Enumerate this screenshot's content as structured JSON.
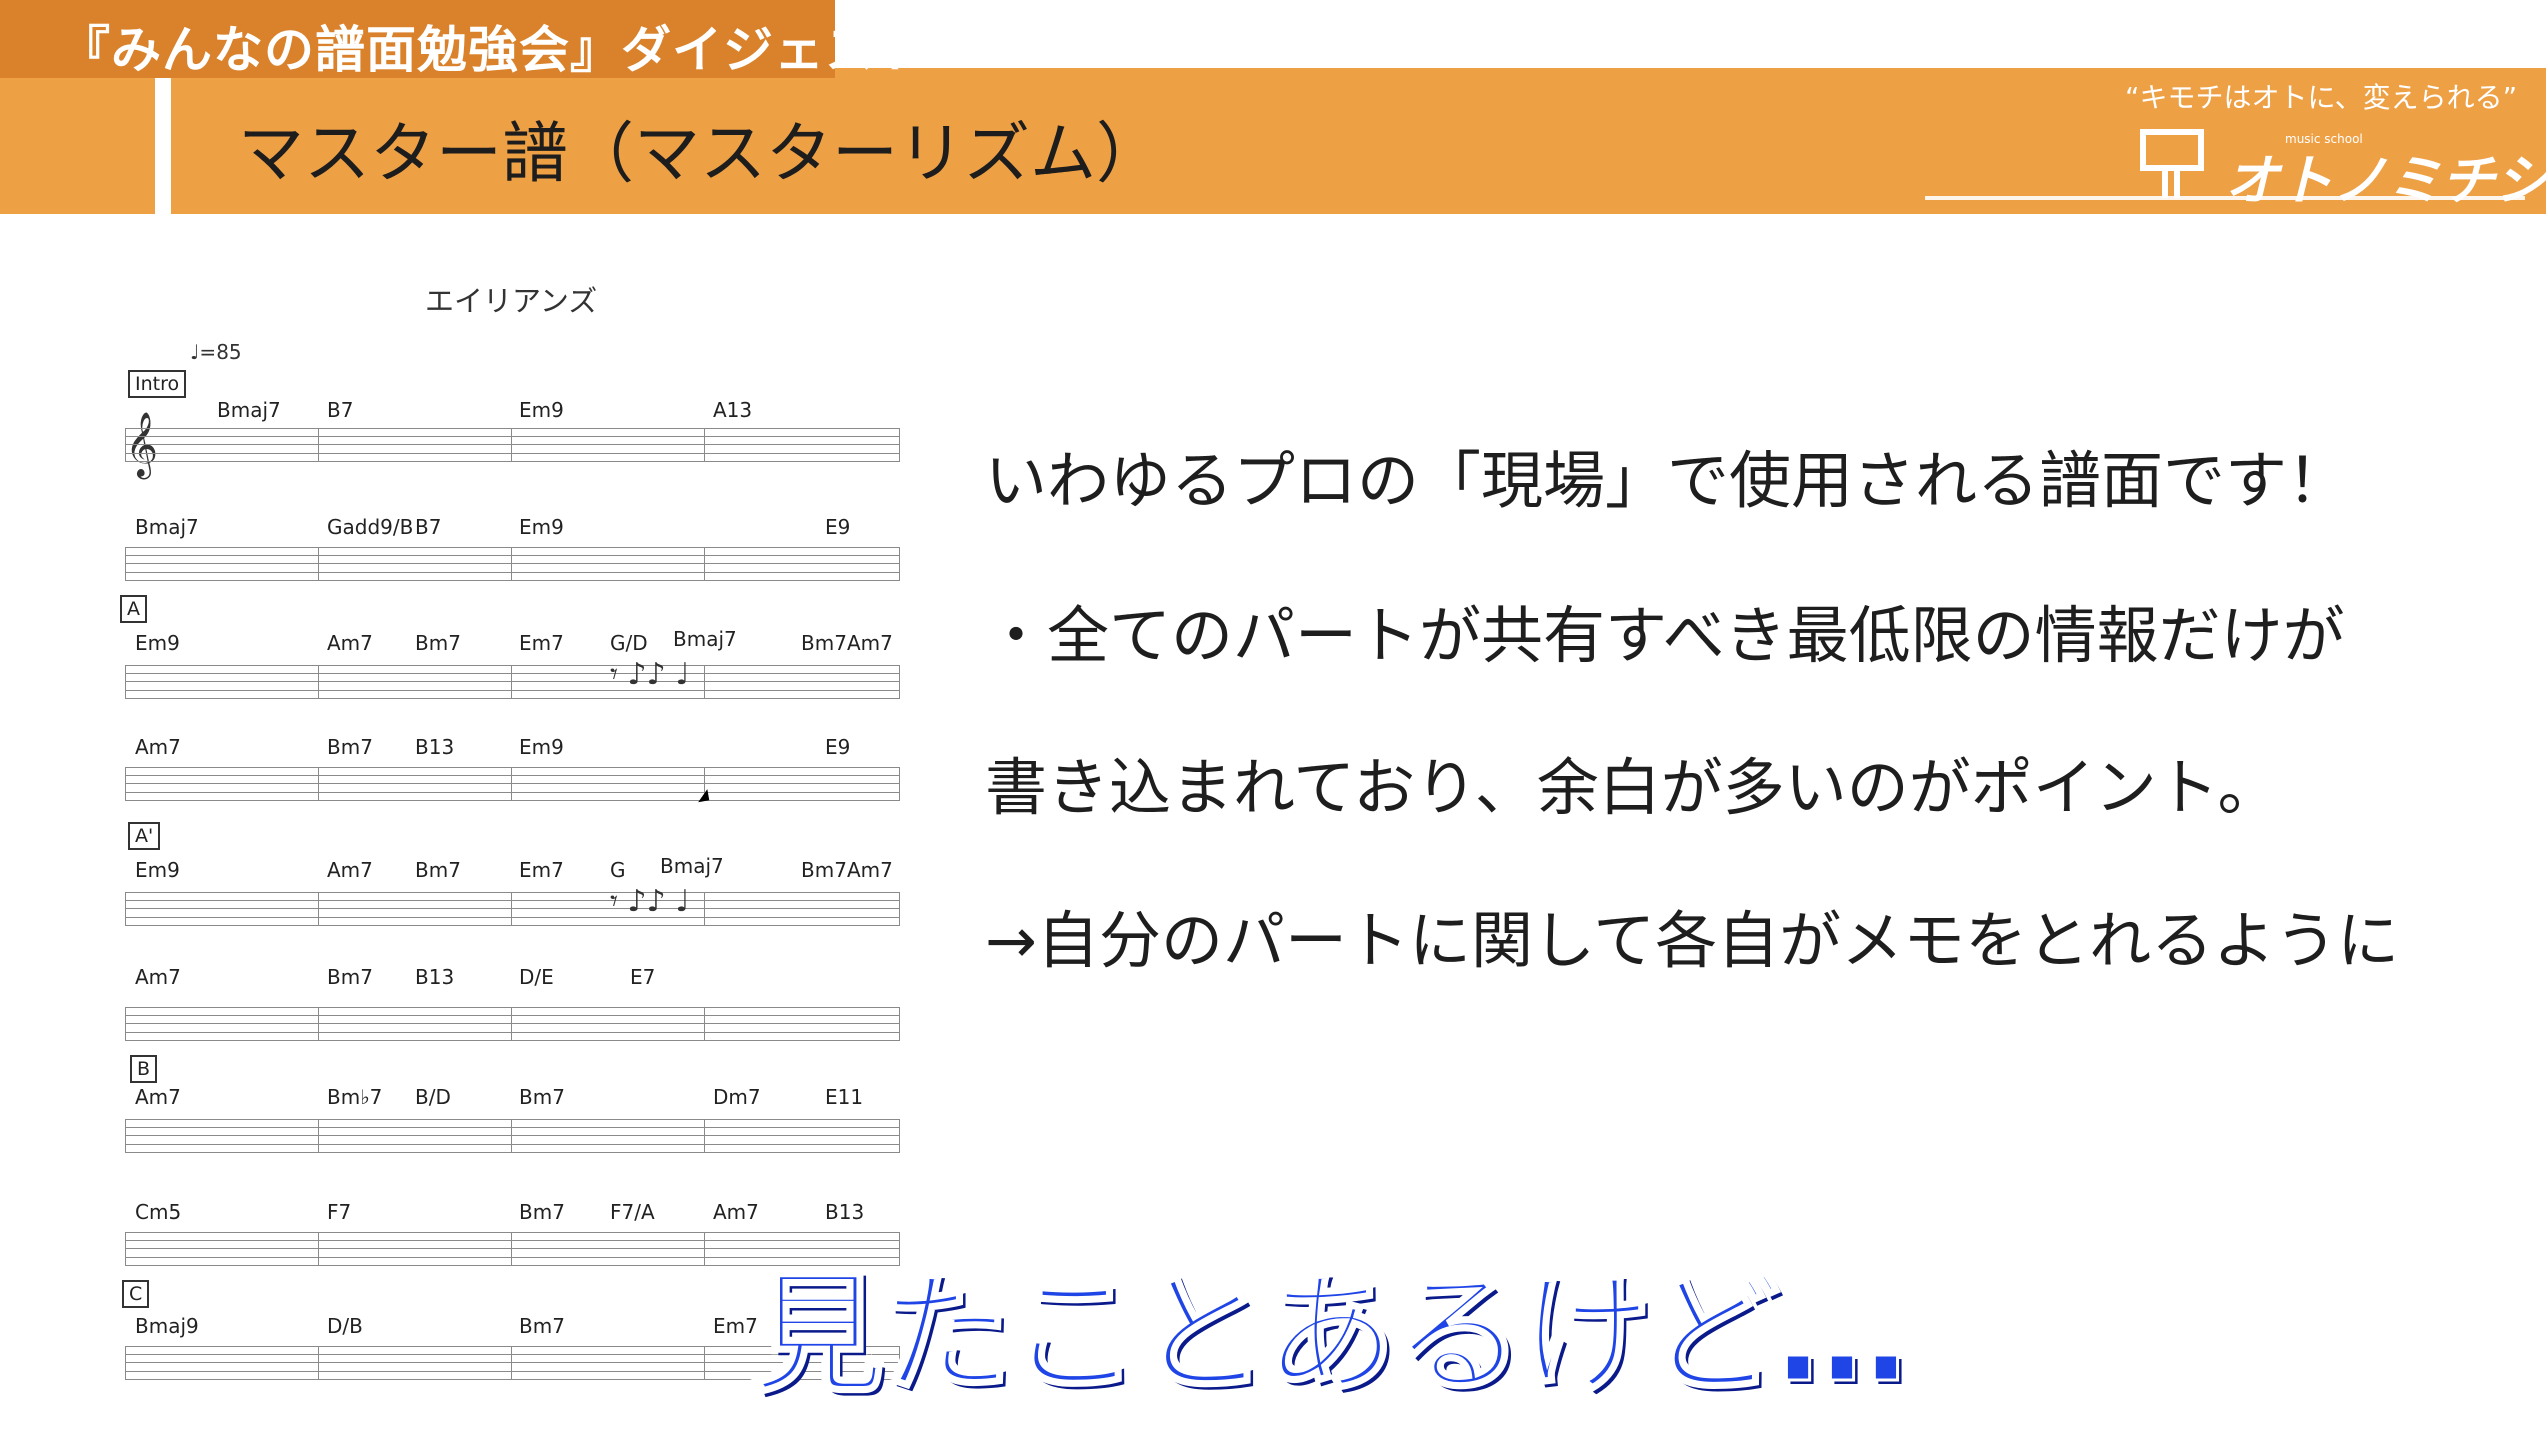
{
  "header": {
    "tagline": "『みんなの譜面勉強会』ダイジェスト♪",
    "slide_title": "マスター譜（マスターリズム）"
  },
  "logo": {
    "catch": "“キモチはオトに、変えられる”",
    "school": "music school",
    "name": "オトノミチシルベ"
  },
  "sheet": {
    "title": "エイリアンズ",
    "tempo": "♩=85",
    "systems": [
      {
        "label": "Intro",
        "chords": [
          "Bmaj7",
          "B7",
          "Em9",
          "A13"
        ]
      },
      {
        "label": "",
        "chords": [
          "Bmaj7",
          "Gadd9/B",
          "B7",
          "Em9",
          "E9"
        ]
      },
      {
        "label": "A",
        "chords": [
          "Em9",
          "Am7",
          "Bm7",
          "Em7",
          "G/D",
          "Bmaj7",
          "Bm7",
          "Am7"
        ]
      },
      {
        "label": "",
        "chords": [
          "Am7",
          "Bm7",
          "B13",
          "Em9",
          "E9"
        ]
      },
      {
        "label": "A'",
        "chords": [
          "Em9",
          "Am7",
          "Bm7",
          "Em7",
          "G",
          "Bmaj7",
          "Bm7",
          "Am7"
        ]
      },
      {
        "label": "",
        "chords": [
          "Am7",
          "Bm7",
          "B13",
          "D/E",
          "E7"
        ]
      },
      {
        "label": "B",
        "chords": [
          "Am7",
          "Bm♭7",
          "B/D",
          "Bm7",
          "Dm7",
          "E11"
        ]
      },
      {
        "label": "",
        "chords": [
          "Cm5",
          "F7",
          "Bm7",
          "F7/A",
          "Am7",
          "B13"
        ]
      },
      {
        "label": "C",
        "chords": [
          "Bmaj9",
          "D/B",
          "Bm7",
          "Em7"
        ]
      }
    ]
  },
  "body": {
    "line1": "いわゆるプロの「現場」で使用される譜面です！",
    "line2": "・全てのパートが共有すべき最低限の情報だけが",
    "line3": "書き込まれており、余白が多いのがポイント。",
    "line4": "→自分のパートに関して各自がメモをとれるように"
  },
  "caption": "見たことあるけど…"
}
